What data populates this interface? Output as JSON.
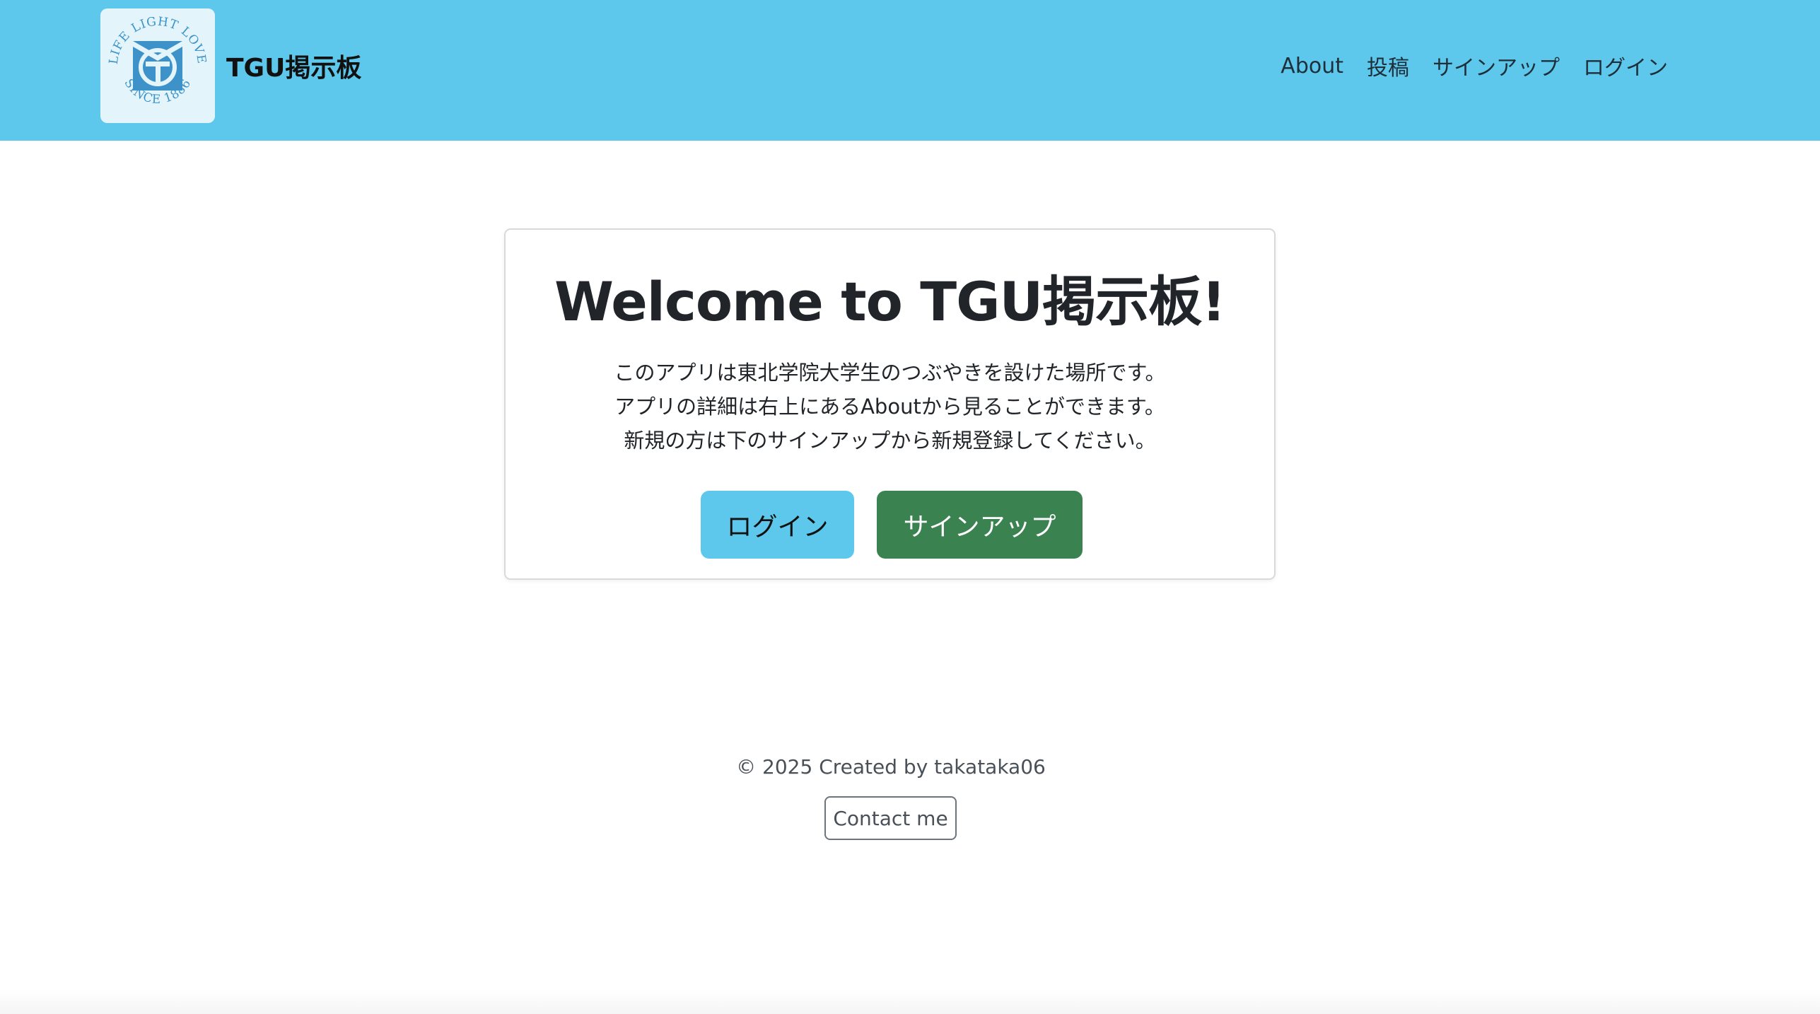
{
  "navbar": {
    "brand_name": "TGU掲示板",
    "logo": {
      "icon": "tgu-logo-icon",
      "ring_text_top": "LIFE LIGHT LOVE",
      "ring_text_bottom": "SINCE 1886"
    },
    "links": [
      {
        "label": "About"
      },
      {
        "label": "投稿"
      },
      {
        "label": "サインアップ"
      },
      {
        "label": "ログイン"
      }
    ]
  },
  "hero": {
    "title": "Welcome to TGU掲示板!",
    "description_lines": [
      "このアプリは東北学院大学生のつぶやきを設けた場所です。",
      "アプリの詳細は右上にあるAboutから見ることができます。",
      "新規の方は下のサインアップから新規登録してください。"
    ],
    "login_button": "ログイン",
    "signup_button": "サインアップ"
  },
  "footer": {
    "copyright": "© 2025 Created by takataka06",
    "contact_button": "Contact me"
  },
  "colors": {
    "navbar_bg": "#5dc8ec",
    "login_button_bg": "#5dc8ec",
    "signup_button_bg": "#3b8251",
    "logo_blue": "#3d93c9"
  }
}
